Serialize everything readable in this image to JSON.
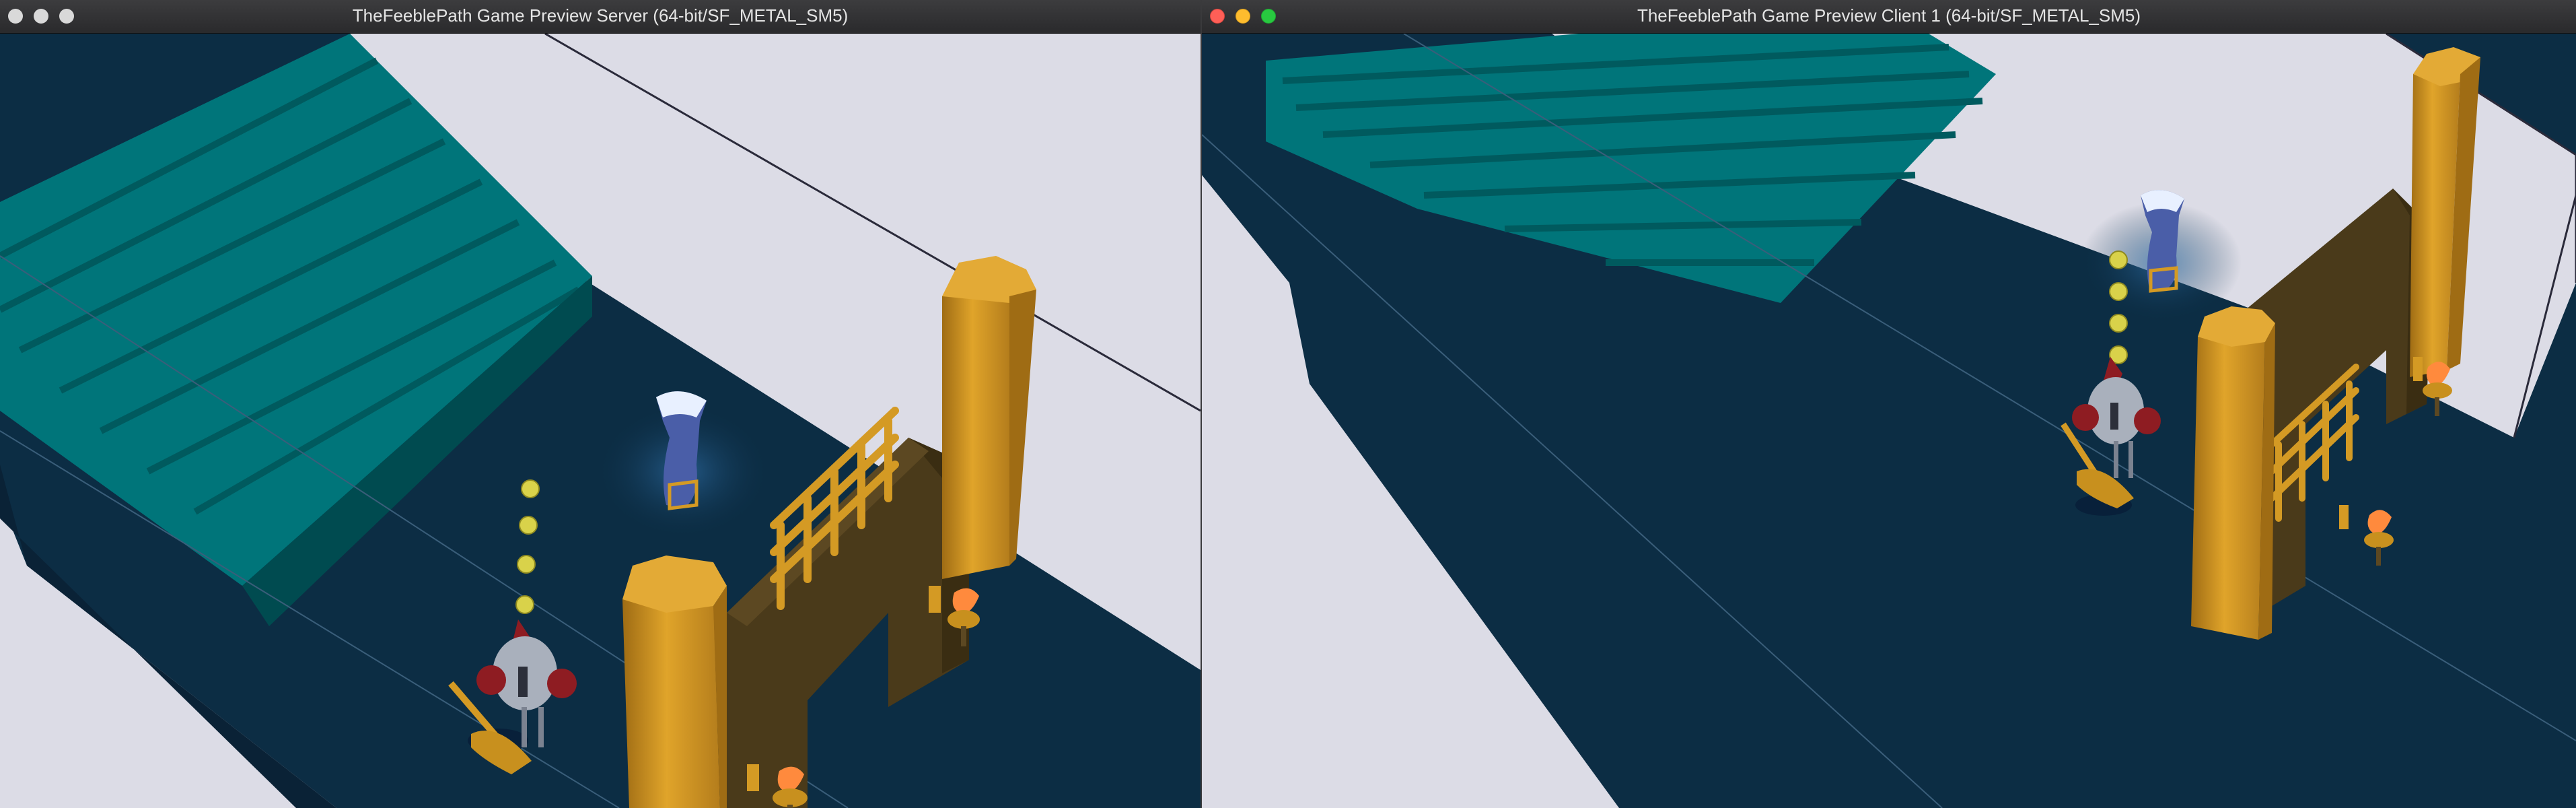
{
  "server_window": {
    "title": "TheFeeblePath Game Preview Server (64-bit/SF_METAL_SM5)",
    "buttons": [
      "close",
      "minimize",
      "zoom"
    ],
    "button_colors": {
      "close": "#d9d9d9",
      "minimize": "#d9d9d9",
      "zoom": "#d9d9d9"
    }
  },
  "client_window": {
    "title": "TheFeeblePath Game Preview Client 1 (64-bit/SF_METAL_SM5)",
    "buttons": [
      "close",
      "minimize",
      "zoom"
    ],
    "button_colors": {
      "close": "#ff5f57",
      "minimize": "#febc2e",
      "zoom": "#28c840"
    }
  },
  "scene_colors": {
    "floor": "#0c2d44",
    "wall": "#dcdce6",
    "stairs": "#00757a",
    "stairs_dark": "#005a5e",
    "gate_wood": "#4a3a1a",
    "pillar": "#d49a24",
    "pillar_dark": "#a8761a",
    "torch_flame": "#ff8a3d",
    "coin": "#d9d24a"
  }
}
